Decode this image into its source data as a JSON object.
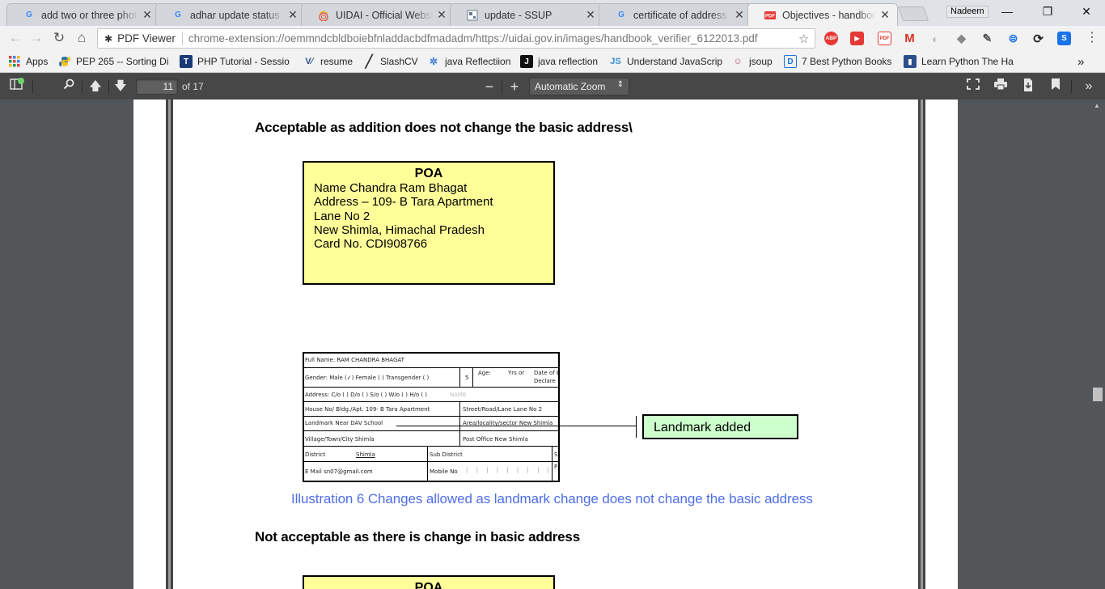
{
  "tabs": [
    {
      "title": "add two or three photo",
      "favicon": "G"
    },
    {
      "title": "adhar update status - G",
      "favicon": "G"
    },
    {
      "title": "UIDAI - Official Website",
      "favicon": "uidai-icon"
    },
    {
      "title": "update - SSUP",
      "favicon": "page-icon"
    },
    {
      "title": "certificate of address is",
      "favicon": "G"
    },
    {
      "title": "Objectives - handbook",
      "favicon": "pdf-icon"
    }
  ],
  "profile_name": "Nadeem",
  "address_bar": {
    "chip_label": "PDF Viewer",
    "url": "chrome-extension://oemmndcbldboiebfnladdacbdfmadadm/https://uidai.gov.in/images/handbook_verifier_6122013.pdf"
  },
  "extensions": {
    "abp": "ABP",
    "gmail": "M"
  },
  "bookmarks": [
    {
      "label": "Apps"
    },
    {
      "label": "PEP 265 -- Sorting Di"
    },
    {
      "label": "PHP Tutorial - Sessio"
    },
    {
      "label": "resume"
    },
    {
      "label": "SlashCV"
    },
    {
      "label": "java Reflectiion"
    },
    {
      "label": "java reflection"
    },
    {
      "label": "Understand JavaScrip"
    },
    {
      "label": "jsoup"
    },
    {
      "label": "7 Best Python Books"
    },
    {
      "label": "Learn Python The Ha"
    }
  ],
  "bookmark_icons": {
    "php": "T",
    "java": "J",
    "js": "JS",
    "books": "D",
    "more": "»"
  },
  "pdf_toolbar": {
    "page_number": "11",
    "page_total": "of 17",
    "zoom": "Automatic Zoom"
  },
  "document": {
    "heading1": "Acceptable as addition does not change the basic address\\",
    "poa1": {
      "title": "POA",
      "lines": [
        "Name   Chandra Ram Bhagat",
        "Address – 109- B Tara Apartment",
        "Lane No 2",
        "New Shimla, Himachal Pradesh",
        "Card No.   CDI908766"
      ]
    },
    "form": {
      "full_name": "Full Name:  RAM CHANDRA BHAGAT",
      "gender": "Gender:   Male (✓)   Female (  )   Transgender (  )",
      "gender_box": "5",
      "age": "Age:",
      "yrs": "Yrs or",
      "dob": "Date of B",
      "declared": "Declare",
      "address": "Address:   C/o ( ) D/o ( ) S/o ( ) W/o ( ) H/o ( )",
      "name_hint": "NAME",
      "house": "House No/ Bldg./Apt.  109- B Tara Apartment",
      "street": "Street/Road/Lane  Lane No 2",
      "landmark": "Landmark  Near DAV School",
      "area": "Area/locality/sector  New Shimla",
      "village": "Village/Town/City  Shimla",
      "post": "Post Office  New Shimla",
      "district": "District",
      "district_val": "Shimla",
      "sub_district": "Sub District",
      "email": "E Mail  sn07@gmail.com",
      "mobile": "Mobile No",
      "s_cut": "S",
      "p_cut": "P"
    },
    "callout": "Landmark added",
    "caption": "Illustration 6 Changes allowed as landmark change does not change the basic address",
    "heading2": "Not acceptable as there is change in basic address",
    "poa2_title": "POA"
  }
}
